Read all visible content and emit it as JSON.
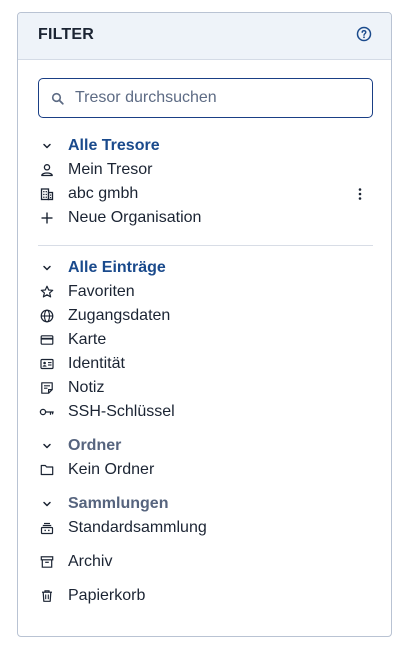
{
  "header": {
    "title": "FILTER",
    "help_icon": "help-circle-icon"
  },
  "search": {
    "placeholder": "Tresor durchsuchen",
    "value": ""
  },
  "vaults": {
    "heading": "Alle Tresore",
    "items": [
      {
        "label": "Mein Tresor",
        "icon": "user-icon"
      },
      {
        "label": "abc gmbh",
        "icon": "building-icon"
      },
      {
        "label": "Neue Organisation",
        "icon": "plus-icon"
      }
    ]
  },
  "types": {
    "heading": "Alle Einträge",
    "items": [
      {
        "label": "Favoriten",
        "icon": "star-icon"
      },
      {
        "label": "Zugangsdaten",
        "icon": "globe-icon"
      },
      {
        "label": "Karte",
        "icon": "credit-card-icon"
      },
      {
        "label": "Identität",
        "icon": "id-card-icon"
      },
      {
        "label": "Notiz",
        "icon": "note-icon"
      },
      {
        "label": "SSH-Schlüssel",
        "icon": "key-icon"
      }
    ]
  },
  "folders": {
    "heading": "Ordner",
    "items": [
      {
        "label": "Kein Ordner",
        "icon": "folder-icon"
      }
    ]
  },
  "collections": {
    "heading": "Sammlungen",
    "items": [
      {
        "label": "Standardsammlung",
        "icon": "collection-icon"
      }
    ]
  },
  "archive": {
    "label": "Archiv",
    "icon": "archive-icon"
  },
  "trash": {
    "label": "Papierkorb",
    "icon": "trash-icon"
  },
  "colors": {
    "accent": "#1a4a8c",
    "muted_heading": "#56647e",
    "text": "#1b2433",
    "header_bg": "#eef3f9",
    "border": "#b9c3d3"
  }
}
